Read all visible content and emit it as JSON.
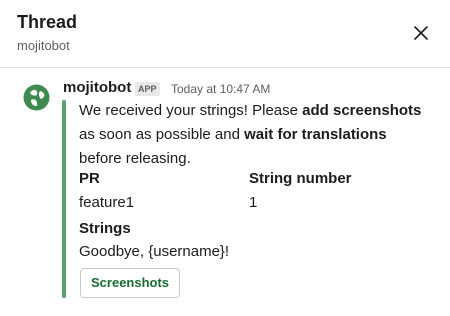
{
  "header": {
    "title": "Thread",
    "subtitle": "mojitobot"
  },
  "message": {
    "author": "mojitobot",
    "badge": "APP",
    "timestamp": "Today at 10:47 AM",
    "text_parts": {
      "l1_a": "We received your strings! Please ",
      "l1_b": "add screenshots",
      "l2_a": "as soon as possible and ",
      "l2_b": "wait for translations",
      "l3": "before releasing."
    },
    "fields": {
      "pr_label": "PR",
      "pr_value": "feature1",
      "string_number_label": "String number",
      "string_number_value": "1",
      "strings_label": "Strings",
      "strings_value": "Goodbye, {username}!"
    },
    "button_label": "Screenshots",
    "accent_color": "#5aa06b"
  }
}
